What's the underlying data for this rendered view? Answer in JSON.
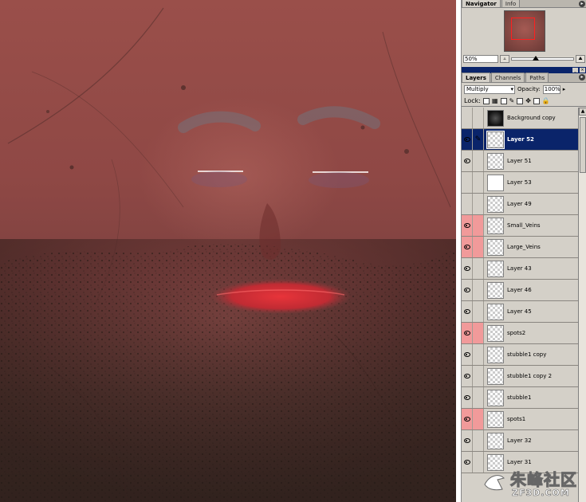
{
  "colors": {
    "panel_bg": "#d4d0c8",
    "selected_row": "#0a246a",
    "highlight_red": "#f19a9a",
    "skin_base": "#8f4845"
  },
  "navigator": {
    "tabs": [
      {
        "label": "Navigator",
        "active": true
      },
      {
        "label": "Info",
        "active": false
      }
    ],
    "zoom": "50%"
  },
  "layers_panel": {
    "tabs": [
      {
        "label": "Layers",
        "active": true
      },
      {
        "label": "Channels",
        "active": false
      },
      {
        "label": "Paths",
        "active": false
      }
    ],
    "blend_mode": "Multiply",
    "opacity_label": "Opacity:",
    "opacity": "100%",
    "lock_label": "Lock:",
    "layers": [
      {
        "name": "Background copy",
        "visible": false,
        "thumb": "bg",
        "red": false,
        "selected": false
      },
      {
        "name": "Layer 52",
        "visible": true,
        "thumb": "checker",
        "red": false,
        "selected": true,
        "brush": true
      },
      {
        "name": "Layer 51",
        "visible": true,
        "thumb": "checker",
        "red": false,
        "selected": false
      },
      {
        "name": "Layer 53",
        "visible": false,
        "thumb": "white",
        "red": false,
        "selected": false
      },
      {
        "name": "Layer 49",
        "visible": false,
        "thumb": "checker",
        "red": false,
        "selected": false
      },
      {
        "name": "Small_Veins",
        "visible": true,
        "thumb": "checker",
        "red": true,
        "selected": false
      },
      {
        "name": "Large_Veins",
        "visible": true,
        "thumb": "checker",
        "red": true,
        "selected": false
      },
      {
        "name": "Layer 43",
        "visible": true,
        "thumb": "checker",
        "red": false,
        "selected": false
      },
      {
        "name": "Layer 46",
        "visible": true,
        "thumb": "checker",
        "red": false,
        "selected": false
      },
      {
        "name": "Layer 45",
        "visible": true,
        "thumb": "checker",
        "red": false,
        "selected": false
      },
      {
        "name": "spots2",
        "visible": true,
        "thumb": "checker",
        "red": true,
        "selected": false
      },
      {
        "name": "stubble1 copy",
        "visible": true,
        "thumb": "checker",
        "red": false,
        "selected": false
      },
      {
        "name": "stubble1 copy 2",
        "visible": true,
        "thumb": "checker",
        "red": false,
        "selected": false
      },
      {
        "name": "stubble1",
        "visible": true,
        "thumb": "checker",
        "red": false,
        "selected": false
      },
      {
        "name": "spots1",
        "visible": true,
        "thumb": "checker",
        "red": true,
        "selected": false
      },
      {
        "name": "Layer 32",
        "visible": true,
        "thumb": "checker",
        "red": false,
        "selected": false
      },
      {
        "name": "Layer 31",
        "visible": true,
        "thumb": "checker",
        "red": false,
        "selected": false
      }
    ]
  },
  "watermark": {
    "cn": "朱峰社区",
    "en": "ZF3D.COM"
  }
}
